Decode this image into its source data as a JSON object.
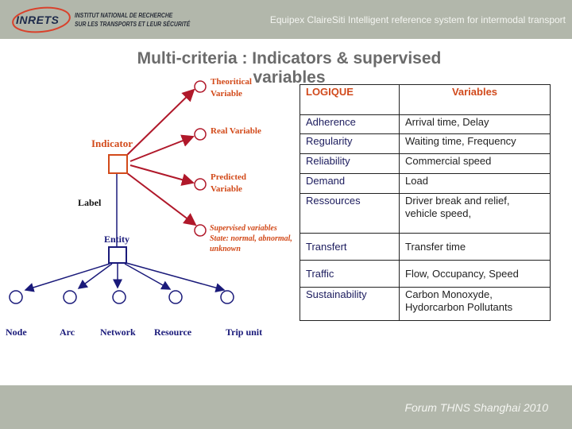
{
  "header": {
    "logo_text": "INRETS",
    "institute_line1": "INSTITUT NATIONAL DE RECHERCHE",
    "institute_line2": "SUR LES TRANSPORTS ET LEUR SÉCURITÉ",
    "title": "Equipex ClaireSiti Intelligent reference system for intermodal transport"
  },
  "slide": {
    "title_line1": "Multi-criteria : Indicators & supervised",
    "title_line2": "variables"
  },
  "diagram": {
    "indicator_label": "Indicator",
    "label_label": "Label",
    "entity_label": "Entity",
    "variables": {
      "theoretical_1": "Theoritical",
      "theoretical_2": "Variable",
      "real": "Real Variable",
      "predicted_1": "Predicted",
      "predicted_2": "Variable",
      "supervised_1": "Supervised variables",
      "supervised_2": "State: normal, abnormal,",
      "supervised_3": "unknown"
    },
    "entity_children": [
      "Node",
      "Arc",
      "Network",
      "Resource",
      "Trip unit"
    ],
    "colors": {
      "indicator": "#d24a1a",
      "arrow_red": "#b0182a",
      "entity": "#1a1a7a"
    }
  },
  "table": {
    "headers": [
      "LOGIQUE",
      "Variables"
    ],
    "rows": [
      [
        "Adherence",
        "Arrival time, Delay"
      ],
      [
        "Regularity",
        "Waiting time, Frequency"
      ],
      [
        "Reliability",
        "Commercial speed"
      ],
      [
        "Demand",
        "Load"
      ],
      [
        "Ressources",
        "Driver break and relief, vehicle speed,"
      ],
      [
        "Transfert",
        "Transfer time"
      ],
      [
        "Traffic",
        "Flow, Occupancy, Speed"
      ],
      [
        "Sustainability",
        "Carbon Monoxyde, Hydorcarbon Pollutants"
      ]
    ]
  },
  "footer": {
    "text": "Forum THNS Shanghai 2010"
  }
}
